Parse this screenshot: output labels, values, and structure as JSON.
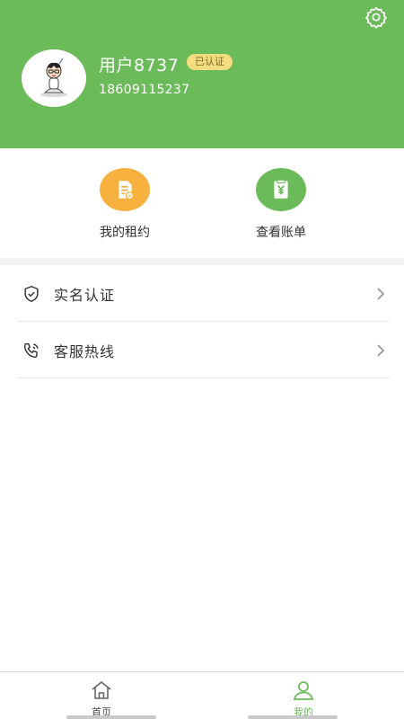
{
  "profile": {
    "username": "用户8737",
    "verified_badge": "已认证",
    "phone": "18609115237"
  },
  "quick_actions": [
    {
      "label": "我的租约",
      "icon": "document-icon",
      "color": "#f6b13e"
    },
    {
      "label": "查看账单",
      "icon": "bill-yen-icon",
      "color": "#6cbb5a"
    }
  ],
  "menu": [
    {
      "label": "实名认证",
      "icon": "shield-check-icon"
    },
    {
      "label": "客服热线",
      "icon": "phone-call-icon"
    }
  ],
  "tabbar": {
    "tabs": [
      {
        "label": "首页",
        "icon": "home-icon",
        "active": false
      },
      {
        "label": "我的",
        "icon": "user-icon",
        "active": true
      }
    ]
  },
  "colors": {
    "brand_green": "#6cbb5a",
    "orange": "#f6b13e",
    "badge_yellow": "#f3dd7e"
  }
}
